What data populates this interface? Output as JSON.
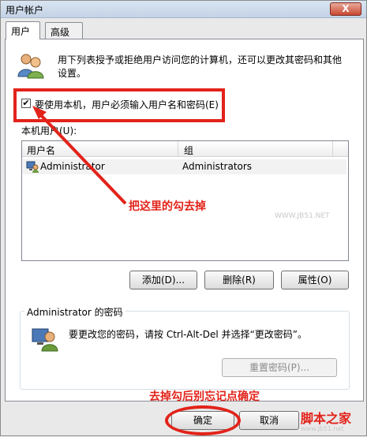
{
  "window": {
    "title": "用户帐户",
    "close_label": "X"
  },
  "tabs": [
    {
      "label": "用户",
      "active": true
    },
    {
      "label": "高级",
      "active": false
    }
  ],
  "description": "用下列表授予或拒绝用户访问您的计算机，还可以更改其密码和其他设置。",
  "require_login": {
    "label": "要使用本机，用户必须输入用户名和密码(E)",
    "checked": true,
    "check_glyph": "✔"
  },
  "local_users": {
    "label": "本机用户(U):",
    "columns": [
      "用户名",
      "组"
    ],
    "rows": [
      {
        "name": "Administrator",
        "group": "Administrators"
      }
    ]
  },
  "buttons": {
    "add": "添加(D)...",
    "remove": "删除(R)",
    "properties": "属性(O)",
    "reset_password": "重置密码(P)...",
    "ok": "确定",
    "cancel": "取消"
  },
  "password_group": {
    "title": "Administrator 的密码",
    "text": "要更改您的密码，请按 Ctrl-Alt-Del 并选择“更改密码”。"
  },
  "annotations": {
    "uncheck": "把这里的勾去掉",
    "confirm": "去掉勾后别忘记点确定"
  },
  "watermark": {
    "list": "WWW.JB51.NET",
    "site_logo": "脚本之家",
    "site_url": "www.jb51.net"
  },
  "colors": {
    "annotation_red": "#e2231a",
    "titlebar": "#c3d3e6",
    "close_button": "#c8472f"
  }
}
